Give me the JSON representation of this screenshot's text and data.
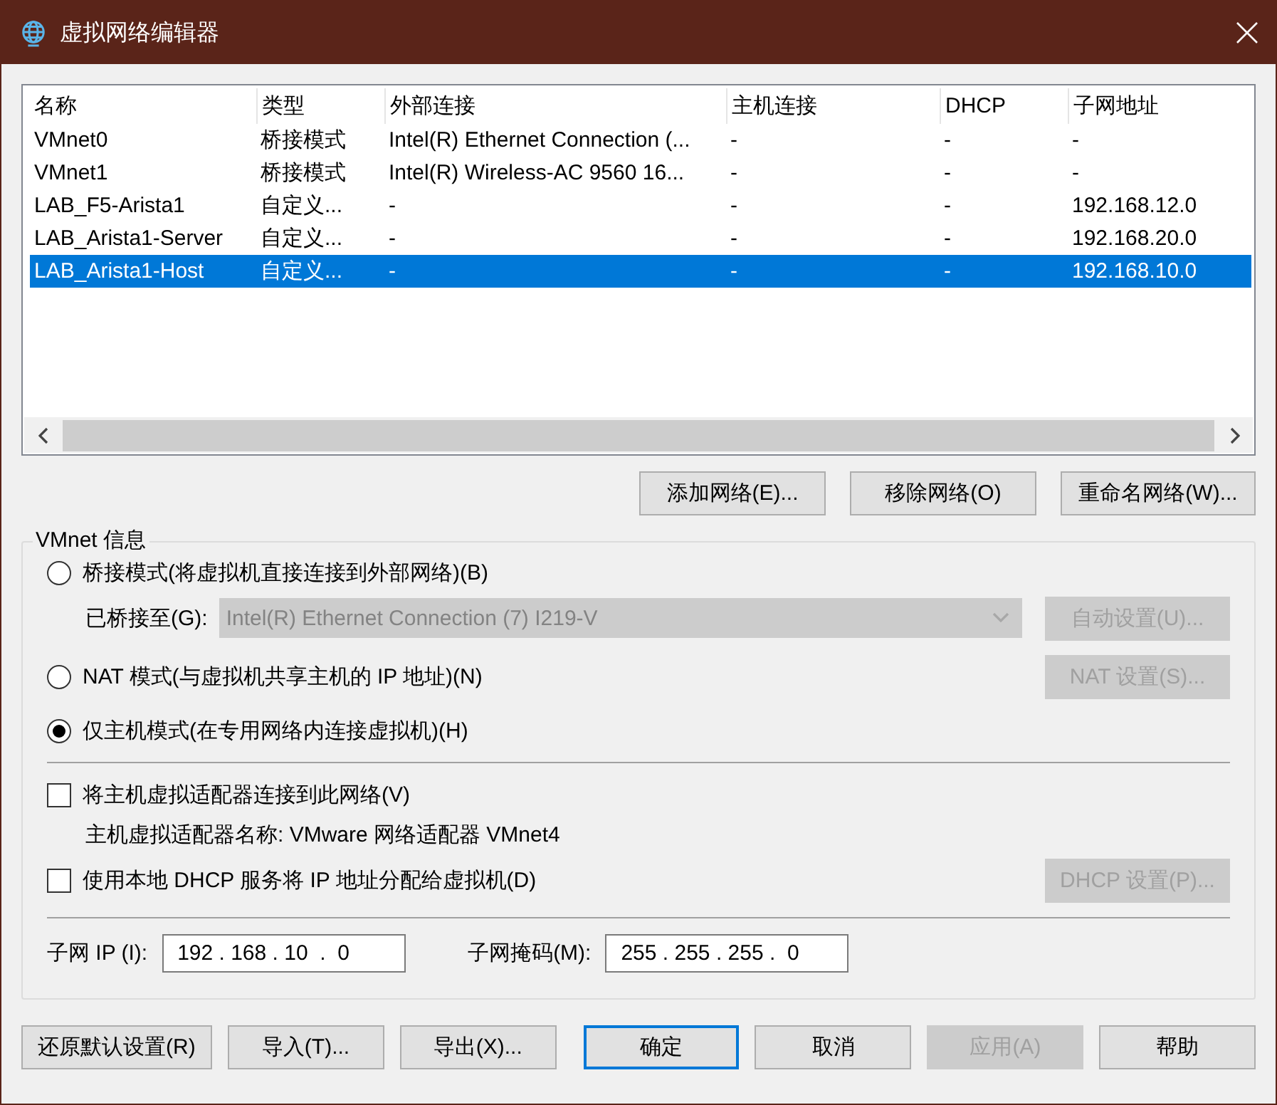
{
  "window": {
    "title": "虚拟网络编辑器"
  },
  "table": {
    "columns": [
      "名称",
      "类型",
      "外部连接",
      "主机连接",
      "DHCP",
      "子网地址"
    ],
    "rows": [
      {
        "cells": [
          "VMnet0",
          "桥接模式",
          "Intel(R) Ethernet Connection (...",
          "-",
          "-",
          "-"
        ],
        "selected": false
      },
      {
        "cells": [
          "VMnet1",
          "桥接模式",
          "Intel(R) Wireless-AC 9560 16...",
          "-",
          "-",
          "-"
        ],
        "selected": false
      },
      {
        "cells": [
          "LAB_F5-Arista1",
          "自定义...",
          "-",
          "-",
          "-",
          "192.168.12.0"
        ],
        "selected": false
      },
      {
        "cells": [
          "LAB_Arista1-Server",
          "自定义...",
          "-",
          "-",
          "-",
          "192.168.20.0"
        ],
        "selected": false
      },
      {
        "cells": [
          "LAB_Arista1-Host",
          "自定义...",
          "-",
          "-",
          "-",
          "192.168.10.0"
        ],
        "selected": true
      }
    ]
  },
  "network_buttons": [
    "添加网络(E)...",
    "移除网络(O)",
    "重命名网络(W)..."
  ],
  "vmnet_info": {
    "title": "VMnet 信息",
    "bridged_mode": {
      "label": "桥接模式(将虚拟机直接连接到外部网络)(B)",
      "selected": false
    },
    "bridged_to": {
      "label": "已桥接至(G):",
      "value": "Intel(R) Ethernet Connection (7) I219-V",
      "disabled": true
    },
    "auto_button": {
      "label": "自动设置(U)...",
      "disabled": true
    },
    "nat_mode": {
      "label": "NAT 模式(与虚拟机共享主机的 IP 地址)(N)",
      "selected": false
    },
    "nat_button": {
      "label": "NAT 设置(S)...",
      "disabled": true
    },
    "host_only_mode": {
      "label": "仅主机模式(在专用网络内连接虚拟机)(H)",
      "selected": true
    },
    "host_adapter": {
      "label": "将主机虚拟适配器连接到此网络(V)",
      "checked": false
    },
    "adapter_name": "主机虚拟适配器名称: VMware 网络适配器 VMnet4",
    "dhcp": {
      "label": "使用本地 DHCP 服务将 IP 地址分配给虚拟机(D)",
      "checked": false
    },
    "dhcp_button": {
      "label": "DHCP 设置(P)...",
      "disabled": true
    },
    "subnet_ip": {
      "label": "子网 IP (I):",
      "value": "192 . 168 . 10  .  0"
    },
    "subnet_mask": {
      "label": "子网掩码(M):",
      "value": "255 . 255 . 255 .  0"
    }
  },
  "footer_buttons": [
    {
      "label": "还原默认设置(R)",
      "disabled": false,
      "default": false
    },
    {
      "label": "导入(T)...",
      "disabled": false,
      "default": false
    },
    {
      "label": "导出(X)...",
      "disabled": false,
      "default": false
    },
    {
      "label": "确定",
      "disabled": false,
      "default": true
    },
    {
      "label": "取消",
      "disabled": false,
      "default": false
    },
    {
      "label": "应用(A)",
      "disabled": true,
      "default": false
    },
    {
      "label": "帮助",
      "disabled": false,
      "default": false
    }
  ]
}
